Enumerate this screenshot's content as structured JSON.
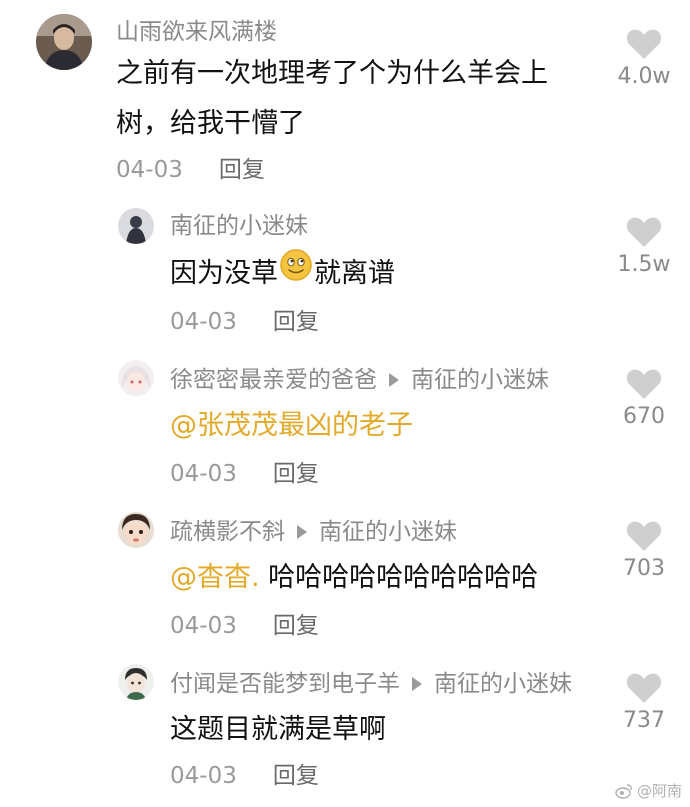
{
  "comments": [
    {
      "username": "山雨欲来风满楼",
      "text_line1": "之前有一次地理考了个为什么羊会上",
      "text_line2": "树，给我干懵了",
      "date": "04-03",
      "reply_label": "回复",
      "likes": "4.0w",
      "avatar_icon": "avatar-man-photo-icon"
    },
    {
      "username": "南征的小迷妹",
      "text_before": "因为没草",
      "emoji": "smirk-emoji-icon",
      "text_after": "就离谱",
      "date": "04-03",
      "reply_label": "回复",
      "likes": "1.5w",
      "avatar_icon": "avatar-dark-figure-icon"
    },
    {
      "username": "徐密密最亲爱的爸爸",
      "reply_to": "南征的小迷妹",
      "mention": "@张茂茂最凶的老子",
      "date": "04-03",
      "reply_label": "回复",
      "likes": "670",
      "avatar_icon": "avatar-anime-girl-icon"
    },
    {
      "username": "疏横影不斜",
      "reply_to": "南征的小迷妹",
      "mention": "@杳杳.",
      "text": " 哈哈哈哈哈哈哈哈哈哈",
      "date": "04-03",
      "reply_label": "回复",
      "likes": "703",
      "avatar_icon": "avatar-baby-face-icon"
    },
    {
      "username": "付闻是否能梦到电子羊",
      "reply_to": "南征的小迷妹",
      "text": "这题目就满是草啊",
      "date": "04-03",
      "reply_label": "回复",
      "likes": "737",
      "avatar_icon": "avatar-cartoon-boy-icon"
    }
  ],
  "watermark": "@阿南",
  "colors": {
    "username": "#8a8a8a",
    "mention": "#e3a92a",
    "heart": "#cfcfcf"
  }
}
